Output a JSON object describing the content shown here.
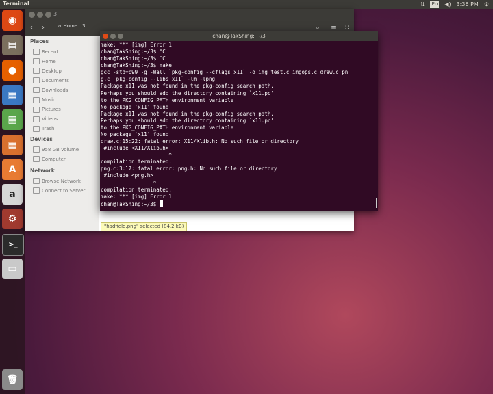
{
  "top_panel": {
    "title": "Terminal",
    "keyboard_layout": "En",
    "time": "3:36 PM"
  },
  "launcher": {
    "items": [
      {
        "name": "dash-home",
        "color": "#dd4814",
        "glyph": "◉"
      },
      {
        "name": "files",
        "color": "#7b6f5e",
        "glyph": "▤"
      },
      {
        "name": "firefox",
        "color": "#e66000",
        "glyph": "●"
      },
      {
        "name": "libreoffice-writer",
        "color": "#3a78c3",
        "glyph": "▦"
      },
      {
        "name": "libreoffice-calc",
        "color": "#5aa64b",
        "glyph": "▦"
      },
      {
        "name": "libreoffice-impress",
        "color": "#d9702e",
        "glyph": "▦"
      },
      {
        "name": "ubuntu-software-center",
        "color": "#e87b33",
        "glyph": "A"
      },
      {
        "name": "amazon",
        "color": "#d6d6d6",
        "glyph": "a"
      },
      {
        "name": "system-settings",
        "color": "#a03a2f",
        "glyph": "⚙"
      },
      {
        "name": "terminal",
        "color": "#2b2b2b",
        "glyph": ">_"
      },
      {
        "name": "drive",
        "color": "#c9c9c9",
        "glyph": "▭"
      }
    ],
    "trash_glyph": "🗑"
  },
  "file_manager": {
    "window_title": "3",
    "breadcrumb_home": "Home",
    "breadcrumb_current": "3",
    "places_heading": "Places",
    "places": [
      "Recent",
      "Home",
      "Desktop",
      "Documents",
      "Downloads",
      "Music",
      "Pictures",
      "Videos",
      "Trash"
    ],
    "devices_heading": "Devices",
    "devices": [
      "958 GB Volume",
      "Computer"
    ],
    "network_heading": "Network",
    "network": [
      "Browse Network",
      "Connect to Server"
    ],
    "status_text": "\"hadfield.png\" selected (84.2 kB)"
  },
  "terminal": {
    "title": "chan@TakShing: ~/3",
    "lines": [
      "make: *** [img] Error 1",
      "chan@TakShing:~/3$ ^C",
      "chan@TakShing:~/3$ ^C",
      "chan@TakShing:~/3$ make",
      "gcc -std=c99 -g -Wall `pkg-config --cflags x11` -o img test.c imgops.c draw.c pn",
      "g.c `pkg-config --libs x11` -lm -lpng",
      "Package x11 was not found in the pkg-config search path.",
      "Perhaps you should add the directory containing `x11.pc'",
      "to the PKG_CONFIG_PATH environment variable",
      "No package 'x11' found",
      "Package x11 was not found in the pkg-config search path.",
      "Perhaps you should add the directory containing `x11.pc'",
      "to the PKG_CONFIG_PATH environment variable",
      "No package 'x11' found",
      "draw.c:15:22: fatal error: X11/Xlib.h: No such file or directory",
      " #include <X11/Xlib.h>",
      "                      ^",
      "compilation terminated.",
      "png.c:3:17: fatal error: png.h: No such file or directory",
      " #include <png.h>",
      "                 ^",
      "compilation terminated.",
      "make: *** [img] Error 1",
      "chan@TakShing:~/3$ "
    ]
  }
}
